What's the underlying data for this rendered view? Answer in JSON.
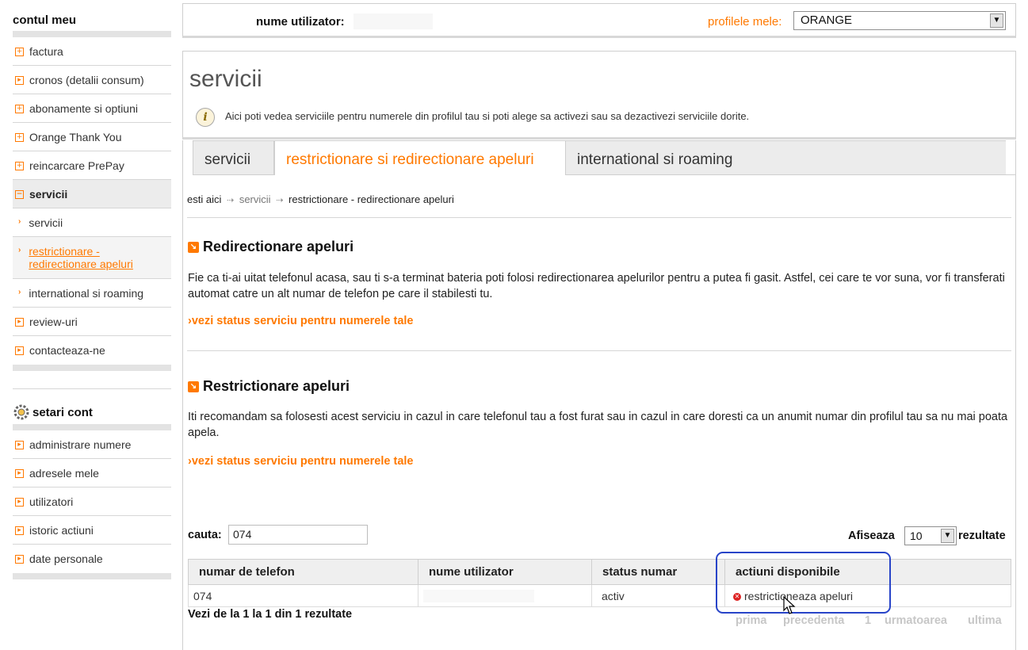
{
  "sidebar": {
    "title": "contul meu",
    "items": [
      {
        "label": "factura"
      },
      {
        "label": "cronos (detalii consum)"
      },
      {
        "label": "abonamente si optiuni"
      },
      {
        "label": "Orange Thank You"
      },
      {
        "label": "reincarcare PrePay"
      },
      {
        "label": "servicii"
      },
      {
        "label": "servicii"
      },
      {
        "label": "restrictionare - redirectionare apeluri"
      },
      {
        "label": "international si roaming"
      },
      {
        "label": "review-uri"
      },
      {
        "label": "contacteaza-ne"
      }
    ],
    "settings_title": "setari cont",
    "settings_items": [
      {
        "label": "administrare numere"
      },
      {
        "label": "adresele mele"
      },
      {
        "label": "utilizatori"
      },
      {
        "label": "istoric actiuni"
      },
      {
        "label": "date personale"
      }
    ]
  },
  "topbar": {
    "user_label": "nume utilizator:",
    "profiles_label": "profilele mele:",
    "profile_value": "ORANGE"
  },
  "header": {
    "title": "servicii",
    "info": "Aici poti vedea serviciile pentru numerele din profilul tau si poti alege sa activezi sau sa dezactivezi serviciile dorite."
  },
  "tabs": [
    {
      "label": "servicii"
    },
    {
      "label": "restrictionare si redirectionare apeluri"
    },
    {
      "label": "international si roaming"
    }
  ],
  "breadcrumb": {
    "prefix": "esti aici",
    "level1": "servicii",
    "level2": "restrictionare - redirectionare apeluri"
  },
  "sections": [
    {
      "title": "Redirectionare apeluri",
      "desc": "Fie ca ti-ai uitat telefonul acasa, sau ti s-a terminat bateria poti folosi redirectionarea apelurilor pentru a putea fi gasit. Astfel, cei care te vor suna, vor fi transferati automat catre un alt numar de telefon pe care il stabilesti tu.",
      "link": "vezi status serviciu pentru numerele tale"
    },
    {
      "title": "Restrictionare apeluri",
      "desc": "Iti recomandam sa folosesti acest serviciu in cazul in care telefonul tau a fost furat sau in cazul in care doresti ca un anumit numar din profilul tau sa nu mai poata apela.",
      "link": "vezi status serviciu pentru numerele tale"
    }
  ],
  "search": {
    "label": "cauta:",
    "value": "074"
  },
  "page_size": {
    "label": "Afiseaza",
    "value": "10",
    "suffix": "rezultate"
  },
  "table": {
    "headers": [
      "numar de telefon",
      "nume utilizator",
      "status numar",
      "actiuni disponibile"
    ],
    "rows": [
      {
        "phone": "074",
        "user": "",
        "status": "activ",
        "action": "restrictioneaza apeluri"
      }
    ]
  },
  "results_text": "Vezi de la 1 la 1 din 1 rezultate",
  "pager": {
    "first": "prima",
    "prev": "precedenta",
    "page": "1",
    "next": "urmatoarea",
    "last": "ultima"
  },
  "colors": {
    "accent": "#ff7900",
    "status_active": "#2a9a2a",
    "highlight": "#2844c8"
  }
}
